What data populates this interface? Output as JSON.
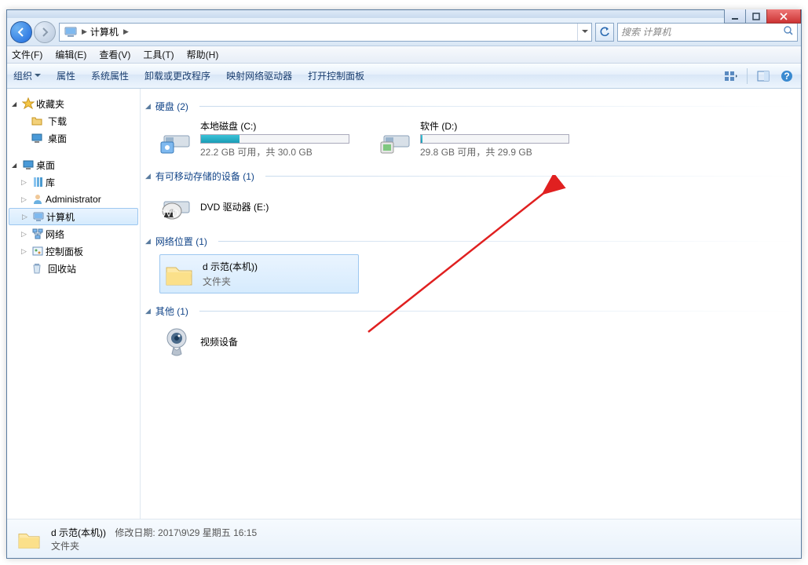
{
  "window": {
    "title": ""
  },
  "nav": {
    "breadcrumb": "计算机",
    "breadcrumb_sep": "▶",
    "search_placeholder": "搜索 计算机"
  },
  "menu": {
    "file": "文件(F)",
    "edit": "编辑(E)",
    "view": "查看(V)",
    "tools": "工具(T)",
    "help": "帮助(H)"
  },
  "toolbar": {
    "organize": "组织",
    "properties": "属性",
    "sys_properties": "系统属性",
    "uninstall": "卸载或更改程序",
    "map_drive": "映射网络驱动器",
    "control_panel": "打开控制面板"
  },
  "sidebar": {
    "favorites": {
      "label": "收藏夹",
      "items": [
        {
          "label": "下载"
        },
        {
          "label": "桌面"
        }
      ]
    },
    "desktop": {
      "label": "桌面",
      "items": [
        {
          "label": "库"
        },
        {
          "label": "Administrator"
        },
        {
          "label": "计算机",
          "selected": true
        },
        {
          "label": "网络"
        },
        {
          "label": "控制面板"
        },
        {
          "label": "回收站"
        }
      ]
    }
  },
  "sections": {
    "hdd": {
      "title": "硬盘 (2)",
      "items": [
        {
          "name": "本地磁盘 (C:)",
          "free_text": "22.2 GB 可用，共 30.0 GB",
          "fill_pct": 26
        },
        {
          "name": "软件 (D:)",
          "free_text": "29.8 GB 可用，共 29.9 GB",
          "fill_pct": 1
        }
      ]
    },
    "removable": {
      "title": "有可移动存储的设备 (1)",
      "items": [
        {
          "name": "DVD 驱动器 (E:)"
        }
      ]
    },
    "network": {
      "title": "网络位置 (1)",
      "items": [
        {
          "name": "d 示范(本机))",
          "sub": "文件夹",
          "selected": true
        }
      ]
    },
    "other": {
      "title": "其他 (1)",
      "items": [
        {
          "name": "视频设备"
        }
      ]
    }
  },
  "details": {
    "name": "d 示范(本机))",
    "type": "文件夹",
    "meta_label": "修改日期:",
    "meta_value": "2017\\9\\29 星期五 16:15"
  }
}
